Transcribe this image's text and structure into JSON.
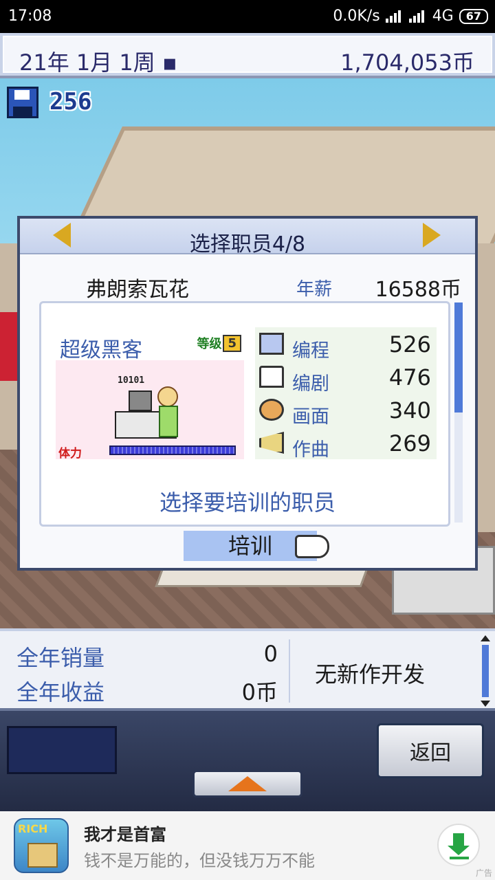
{
  "status_bar": {
    "time": "17:08",
    "network_speed": "0.0K/s",
    "network_type": "4G",
    "battery": "67"
  },
  "top_bar": {
    "date": "21年 1月 1周 ▪",
    "money": "1,704,053币"
  },
  "save": {
    "count": "256",
    "icon": "floppy-disk-icon"
  },
  "dialog": {
    "title": "选择职员4/8",
    "staff_name": "弗朗索瓦花",
    "salary_label": "年薪",
    "salary_value": "16588币",
    "job_title": "超级黑客",
    "level_label": "等级",
    "level_value": "5",
    "code_text": "10101",
    "stamina_label": "体力",
    "stamina_level": 1.0,
    "stats": [
      {
        "label": "编程",
        "value": "526",
        "icon": "computer-icon"
      },
      {
        "label": "编剧",
        "value": "476",
        "icon": "book-icon"
      },
      {
        "label": "画面",
        "value": "340",
        "icon": "palette-icon"
      },
      {
        "label": "作曲",
        "value": "269",
        "icon": "trumpet-icon"
      }
    ],
    "prompt": "选择要培训的职员",
    "train_button": "培训"
  },
  "info": {
    "annual_sales_label": "全年销量",
    "annual_sales_value": "0",
    "annual_revenue_label": "全年收益",
    "annual_revenue_value": "0币",
    "dev_status": "无新作开发"
  },
  "controls": {
    "back_label": "返回"
  },
  "ad": {
    "icon_text": "RICH",
    "title": "我才是首富",
    "subtitle": "钱不是万能的，但没钱万万不能",
    "tag": "广告"
  },
  "colors": {
    "accent_blue": "#3b5dab",
    "dialog_border": "#3d4a6b",
    "highlight": "#a9c3f2",
    "stamina_red": "#d01b1b"
  }
}
